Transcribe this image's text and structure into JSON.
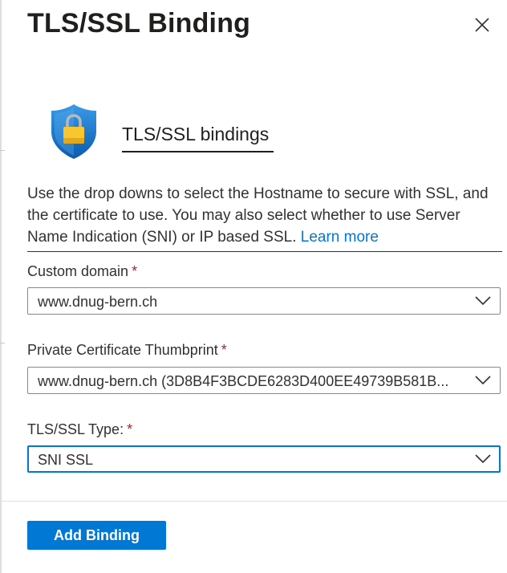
{
  "panel": {
    "title": "TLS/SSL Binding"
  },
  "section": {
    "icon": "shield-lock-icon",
    "title": "TLS/SSL bindings"
  },
  "description": {
    "text": "Use the drop downs to select the Hostname to secure with SSL, and the certificate to use. You may also select whether to use Server Name Indication (SNI) or IP based SSL.",
    "link_label": "Learn more"
  },
  "fields": {
    "custom_domain": {
      "label": "Custom domain",
      "required_marker": "*",
      "value": "www.dnug-bern.ch"
    },
    "thumbprint": {
      "label": "Private Certificate Thumbprint",
      "required_marker": "*",
      "value": "www.dnug-bern.ch (3D8B4F3BCDE6283D400EE49739B581B..."
    },
    "ssl_type": {
      "label": "TLS/SSL Type:",
      "required_marker": "*",
      "value": "SNI SSL"
    }
  },
  "actions": {
    "add_binding_label": "Add Binding"
  },
  "colors": {
    "accent": "#0078d4",
    "required": "#a4262c",
    "text": "#323130"
  }
}
